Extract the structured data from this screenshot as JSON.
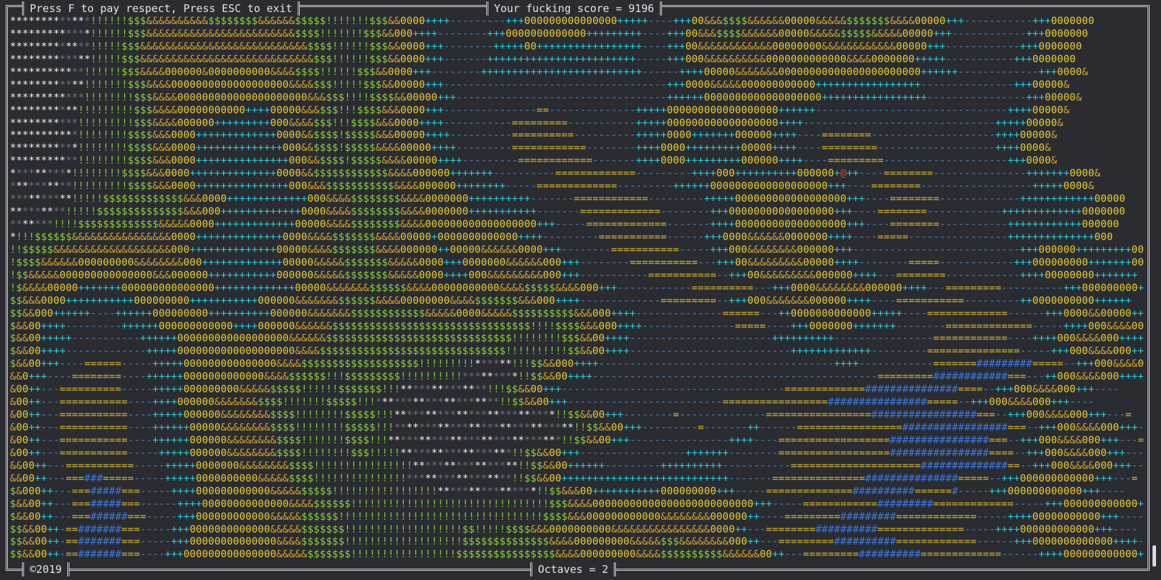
{
  "header": {
    "help_text": "Press F to pay respect, Press ESC to exit",
    "score_text": "Your fucking score = 9196"
  },
  "footer": {
    "copyright_text": "©2019",
    "octaves_text": "Octaves = 2"
  },
  "game": {
    "player_glyph": "@",
    "player_row": 13,
    "player_col": 137,
    "field_rows": [
      "*************!!!!!!$$$&&&&&&&&&&$$$$$$$$&&&&&&$$$$$!!!!!!!$$$&&0000++++---------+++000000000000000+++++----+++00&&&$$$$&&&&&&00000&&&&&$$$$$$$&&&&00000+++-----------+++0000000",
      "*************!!!!!!$$$&&&&&&&&&&&&&&&&&&&&&&&&$$$$!!!!!!!$$$&&000++++--------+++0000000000000+++++++++----+++00&&&$$$$&&&&&&00000&&&&&$$$$$&&&&&00000+++------------+++0000000",
      "*************!!!!!$$$&&&&&&&&&&&&&&&&&&&&&&&&&&&$$$$!!!!!!$$$&&0000+++--------+++++00+++++++++++++++++----+++00&&&&&&&&&&&&00000000&&&&&&&&&&&&00000+++------------+++0000000",
      "*************!!!!!$$$&&&&&&&&&&&&&&&&&&&&&&&&&&&&$$$!!!!!!$$$&&0000+++-------++++++++++++++++++++++++-----+++000&&&&&&&&&&0000000000000&&&&0000000+++++-----------+++0000000",
      "************!!!!!!$$$&&&&000000&0000000000&&&&$$$$!!!!!!$$$&&0000+++--------++++++++++++++++++++++++++------++++00000&&&&&&&00000000000000000000000++++++-------------+++0000&",
      "************!!!!!!!$$$&&&&0000000000000000000&&&&$$$!!!!!$$$&&00000+++------------------------------------+++0000&&&&&000000000000+++++++++++++++++---------------+++00000&",
      "************!!!!!!!!$$$&&&&000000000000000000000&&&$$$!!!!$$$$&&00000+++----------------------------------++++++0000000000000000000+++++++++++++++++----------------+++00000&",
      "***********!!!!!!!!!$$$&&&&00000000000++++00000&&&$$$!!!$$$$&&&0000+++---------------==--------------+++++000000000000000000++++++-------------------------------++++00000&",
      "***********!!!!!!!!!$$$&&&&000000+++++++++000&&&&$$$!!!$$$$&&&0000++++-----------=========-----------+++++000000000000000000++++-------------------------------+++++00000&",
      "***********!!!!!!!!$$$$&&&0000+++++++++++++0000&&$$$$!$$$$$&&&00000++++----------==========----------+++++0000+++++++000000++++----========--------------------++++00000&",
      "***********!!!!!!!!$$$$&&&0000++++++++++++++000&&$$$$!$$$$$&&&&00000++++---------============--------++++0000+++++++++00000++++----=========-------------------++++0000&",
      "***********!!!!!!!!$$$$&&&0000+++++++++++++++000&&$$$$!$$$$$&&&&00000++++---------============-------++++0000+++++++++000000++++----=========--------------------+++0000&",
      "**********!!!!!!!!$$$$&&&0000++++++++++++++0000&&$$$$$$$$$$$$&&&&000000+++++++----------=============---------++++000++++++++++000000+@++----========---------------+++++++0000&",
      "**********!!!!!!!!!$$$$&&&0000+++++++++++++++000&&&$$$$$$$$$$$&&&&000000++++++++-----=============---------++++++0000000000000000000+++----========------------------+++++0000&",
      "**********!!!!!$$$$$$$$$$$$$&&&0000+++++++++++++000&&&&$$$$$$$$&&&&0000000++++++++++-------============---------+++++000000000000000000+++----========-------------++++++++++++00000",
      "*********!!!!!$$$$$$$$$$$$$$&&&000+++++++++++++0000&&&&$$$$$$$$&&&&0000000+++++++++++-------=============--------+++00000000000000000+++----========------------+++++++++++++0000000",
      "*******!!!!$$$$$$$$$$$$$&&&&&0000+++++++++++++00000&&&&$$$$$$$$&&&&000000000000000000+++-----=============-------++++000000000000000000+++----========-----------++++++++++++000000",
      "*!!!$$$$$$&&&&&&&&&&&&&&&&0000++++++++++++++0000&&&&$$$$$$$&&&&00000+0000000000000++++---------===========------+++0000&&&&&&0000000++++----=====----------------++++++++++++++000",
      "!!$$$$$&&&&&&&&&&&&&&&&&&&000++++++++++++++00000&&&&$$$$$$$&&&&000000++00000&&&&&&0000+++--------===========-----+++000&&&&&&&&000000+++---------------------------+++000000+++++++++000",
      "!$$$$&&&&&&000000000&&&&&&&&000+++++++++++++00000&&&&&$$$$$$$&&&&&0000+++0000000&&&&&&000+++--------===========---+++00&&&&&&&&&00000++++--------=====------------+++000000000+++++++00",
      "!$$&&&&&000000000000000&&&000000+++++++++++000000&&&&&$$$$$$$&&&&&0000++++000&&&&&&&&&000+++-----------===========--+++00&&&&&&&&&000000++++---========------------++++00000000+++++++",
      "!$&&&&00000+++++++000000000000000+++++++++++++00000&&&&&&&$$$$$$&&&&00000000000&&&&$$$$$&&&&000+++------------==========---+++0000&&&&&&&&000000++++---=========----------+++000000000+++++++",
      "$$&&&0000+++++++++++000000000+++++++++++000000&&&&&&&$$$$$$&&&&00000000&&&&$$$$$$$&&&000++++-------------=========--+++000&&&&&&&000000++++----===========---------++0000000000++++++",
      "$$&&000++++++----++++++000000000++++++++++000000&&&&&&&$$$$$$$$$$$$&&&&&0000&&&&&$$$$$$$$$$&&&000++++--------------======---++0000000000000+++++----=============------+++0000&&00000++++++",
      "$&&00++++---------++++++000000000000++++000000&&&&&&$$$$$$$$$$$$$$$$$$$$$$$$$$$$$$$$!!!!$$$$&&&000++++---------------=====----+++0000000+++++++--------==============-----++++000&&&&00000+++++",
      "$&&00+++++-----------++++++000000000000000000&&&&&&$$$$$$$$$$$$$$$$$$$$$$$$$$$$$$!!!!!!!!$$$&&00++++-----------------------++++++++++----------------============----++++000&&&&000++++++",
      "$&&00++++-------------+++++0000000000000000000&&&&$$$$$$$$$$$$$$$$$$$$$$$$$$$$$$!!!!!!!!!!$$&&00++++--------------------------+++++++++++++---------===============-----+++000&&&&000++++++",
      "$&&00+++----======-----+++++000000000000000&&&&$$$$$$$$$$$$$$$$$$$!!!!!!!!!******!!!$$&&000++++--------------------------------------++++------------=======#########=====--+++000&&&&000+++----",
      "&&0+++----========----++++++0000000000000&&&&$$$$$$!!!$$$$$$$$$!!!!!!!!!!*********!!$$&&00++++----------------------------------------------=========############===---++000&&&&000++++---",
      "&00++---==========-----+++++000000000&&&&&$$$$$!!!!!!$$$$$$$!!!**************!!!$$&&00+++------------------------------------=============###############====--+++000&&&&000+++----",
      "&00++---===========----++++000000&&&&&&&$$$$!!!!!!!$$$$$!!!********************!!$$&&00+++-------------------------=================################=====--+++000&&&&000+++----",
      "&00++---===========----+++++000000&&&&&&&&$$$$!!!!!!!!$$$$$!!!**************************!!$$&&00+++--------=--------------=================#################===--+++000&&&&000+++---=",
      "&00++---===========----++++++00000&&&&&&&&$$$$!!!!!!!!$$$$$!!!*****************************!!$$&&00+++---------=-------++------=================#################===--+++000&&&&000+++---=",
      "&00++---===========----++++++000000&&&&&&&&$$$$!!!!!!!$$$$!!!****************************!!$$&&00+++----------------++++----==================################===--+++000&&&&000+++---=",
      "&00++---===========-----+++++000000&&&&&&&&$$$$!!!!!!!!$$$!!!!!******************!!$$&&00+++-----------------+++++++--------==================################====--+++000&&&&000+++---=",
      "&&00++---===========-----+++++0000000&&&&&&&&$$$$!!!!!!!!!!!!!!!!*****************!!$$&&00++++++---------++++++++++-----------=====================##############==--+++000&&&&000+++---=",
      "&&00++---===###=====-----+++++0000000000&&&&&$$$$!!!!!!!!!!!!!!!*****************!!$$&&00+++++++++++++++++++++++++++-------===============###############=====--+++000000000000+++---=",
      "$&000++---===#####===-----++++000000000000&&&&&$$$$$!!!!!!!!!!!!!!!!!****************!!$$&&&00+++++++++++000000000+++-----==============##########======#-----+++000000000000+++----",
      "$&&00++---===#####===------++++00000000000000&&&&$$$$$$!!!!!!!!!!!!!!!!!!!!!!!!!!!!!!!!$$$&&&&00000000000000000000000000+++-----============#########=============-----+++000000000000+++----",
      "$&&00++---===######===-----+++000000000000&&&&&$$$$$$!!!!!!!!!!!!!!!!!!!!!!!!!!!!!!!!!$$$$&&&000000000000&&&&&&&&000000++----=========#########=============-----++++00000000000+++----",
      "$$&&00++-==#######===-----+++0000000000000&&&&&$$$$$$$!!!!!!!!!!!!!!!!!!!$$!!!!!$$$$&&&0000000000&&&&&&&&&&&&&&&&0000++---========##########==============-----++++000000000000+++----",
      "$$&&00++-==#######===-----+++00000000000000&&&&$$$$$$$!!!!!!!!!!!!!!!!!!!$$$$$$$$$$$$$$&&&&000000000&&&&&$$$&&&&&&&&000++---=========##########=============------+++0000000000000++++---",
      "$$&&00++-==#######===----+++000000000000000&&&&&$$$$$$$!!!!!!!!!!!!!!!!!$$$$$$$$$$$$$$$$&&&&000000000&&&&$$$$$$$$$$&&&&&&00++---=========##########=============------++++000000000000+++++---"
    ]
  }
}
